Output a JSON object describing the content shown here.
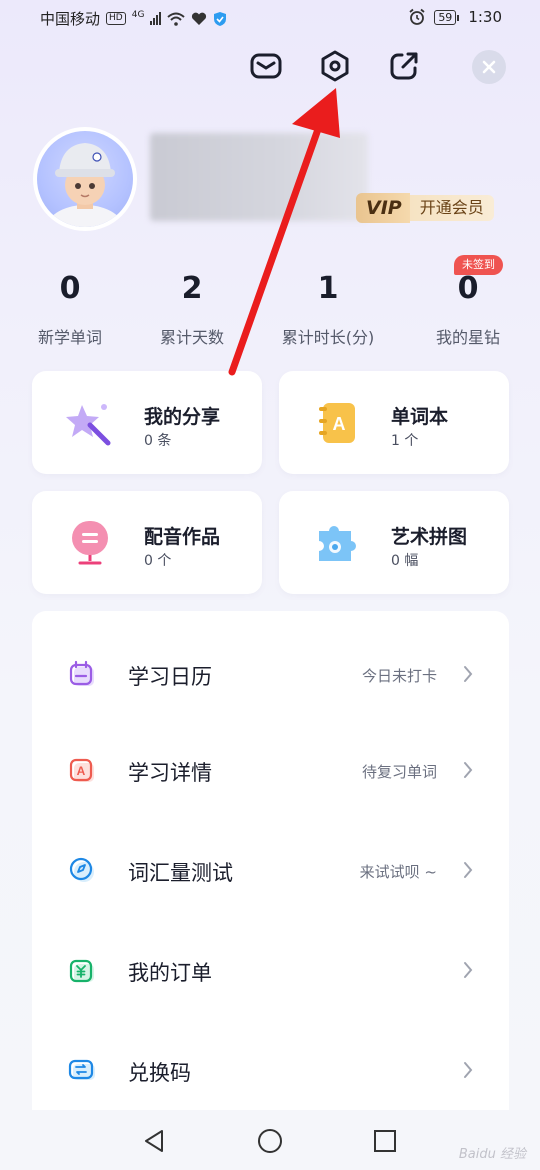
{
  "status_bar": {
    "carrier": "中国移动",
    "hd": "HD",
    "network": "4G",
    "battery": "59",
    "time": "1:30"
  },
  "top_icons": [
    "mail-icon",
    "settings-icon",
    "share-icon",
    "close-icon"
  ],
  "profile": {
    "vip_logo": "VIP",
    "vip_cta": "开通会员"
  },
  "stats": [
    {
      "value": "0",
      "label": "新学单词"
    },
    {
      "value": "2",
      "label": "累计天数"
    },
    {
      "value": "1",
      "label": "累计时长(分)"
    },
    {
      "value": "0",
      "label": "我的星钻"
    }
  ],
  "unsigned_badge": "未签到",
  "cards": [
    {
      "title": "我的分享",
      "sub": "0 条",
      "icon": "magic-wand-icon"
    },
    {
      "title": "单词本",
      "sub": "1 个",
      "icon": "wordbook-icon"
    },
    {
      "title": "配音作品",
      "sub": "0 个",
      "icon": "microphone-icon"
    },
    {
      "title": "艺术拼图",
      "sub": "0 幅",
      "icon": "puzzle-icon"
    }
  ],
  "menu": [
    {
      "label": "学习日历",
      "status": "今日未打卡",
      "icon": "calendar-icon"
    },
    {
      "label": "学习详情",
      "status": "待复习单词",
      "icon": "study-detail-icon"
    },
    {
      "label": "词汇量测试",
      "status": "来试试呗 ~",
      "icon": "compass-icon"
    },
    {
      "label": "我的订单",
      "status": "",
      "icon": "order-icon"
    },
    {
      "label": "兑换码",
      "status": "",
      "icon": "redeem-icon"
    }
  ],
  "watermark": "Baidu 经验",
  "colors": {
    "accent_red": "#ef5350",
    "vip_gold": "#e9c48f",
    "background": "#f1f0fb"
  }
}
